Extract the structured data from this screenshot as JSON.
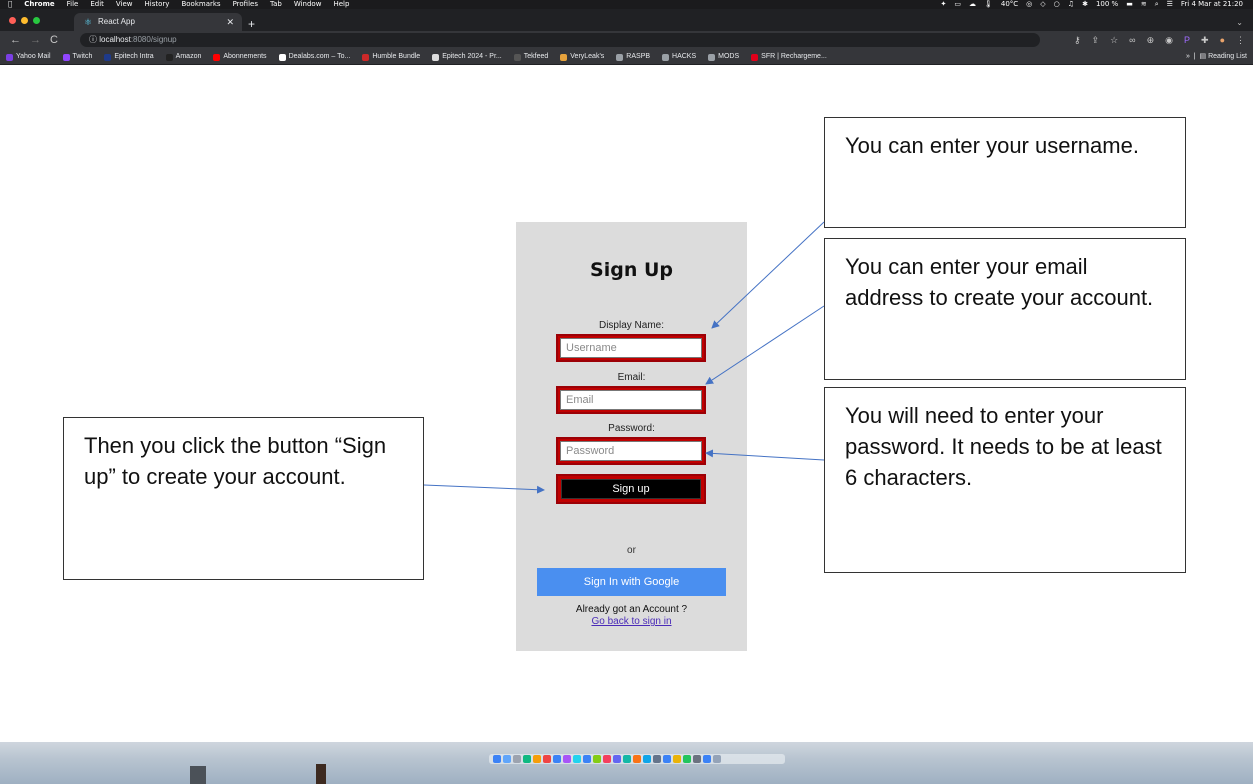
{
  "menubar": {
    "app": "Chrome",
    "items": [
      "File",
      "Edit",
      "View",
      "History",
      "Bookmarks",
      "Profiles",
      "Tab",
      "Window",
      "Help"
    ],
    "status": [
      "40°C",
      "100 %",
      "Fri 4 Mar at 21:20"
    ]
  },
  "tabs": [
    {
      "title": "React App",
      "favicon": "react-icon"
    }
  ],
  "toolbar": {
    "url_host": "localhost",
    "url_path": ":8080/signup"
  },
  "bookmarks": [
    {
      "label": "Yahoo Mail",
      "color": "#7b3fe4"
    },
    {
      "label": "Twitch",
      "color": "#9146ff"
    },
    {
      "label": "Epitech Intra",
      "color": "#1e3a8a"
    },
    {
      "label": "Amazon",
      "color": "#222222"
    },
    {
      "label": "Abonnements",
      "color": "#ff0000"
    },
    {
      "label": "Dealabs.com – To...",
      "color": "#ffffff"
    },
    {
      "label": "Humble Bundle",
      "color": "#cc2929"
    },
    {
      "label": "Epitech 2024 - Pr...",
      "color": "#dddddd"
    },
    {
      "label": "Tekfeed",
      "color": "#555555"
    },
    {
      "label": "VeryLeak's",
      "color": "#e6a23c"
    },
    {
      "label": "RASPB",
      "color": "#9aa0a6"
    },
    {
      "label": "HACKS",
      "color": "#9aa0a6"
    },
    {
      "label": "MODS",
      "color": "#9aa0a6"
    },
    {
      "label": "SFR | Rechargeme...",
      "color": "#e2001a"
    }
  ],
  "reading_list": "Reading List",
  "signup": {
    "title": "Sign Up",
    "display_name_label": "Display Name:",
    "username_placeholder": "Username",
    "email_label": "Email:",
    "email_placeholder": "Email",
    "password_label": "Password:",
    "password_placeholder": "Password",
    "signup_button": "Sign up",
    "or": "or",
    "google_button": "Sign In with Google",
    "already": "Already got an Account ?",
    "back_link": "Go back to sign in"
  },
  "callouts": {
    "username": "You can enter your username.",
    "email": "You can enter your email address to create your account.",
    "password": "You will need to enter your password. It needs to be at least 6 characters.",
    "signup": "Then you click the button “Sign up” to create your account."
  },
  "colors": {
    "highlight": "#c00000",
    "google": "#4a8ff0",
    "card": "#dcdcdc"
  }
}
